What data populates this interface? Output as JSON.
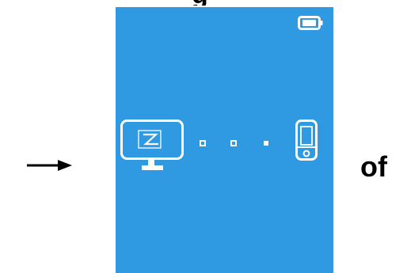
{
  "page": {
    "top_fragment": "g",
    "side_text": "of"
  },
  "device_screen": {
    "background": "#2f9ae2",
    "icons": {
      "status": "battery-icon",
      "computer": "monitor-icon",
      "connection": "dotted-connection-icon",
      "player": "portable-media-player-icon"
    }
  }
}
